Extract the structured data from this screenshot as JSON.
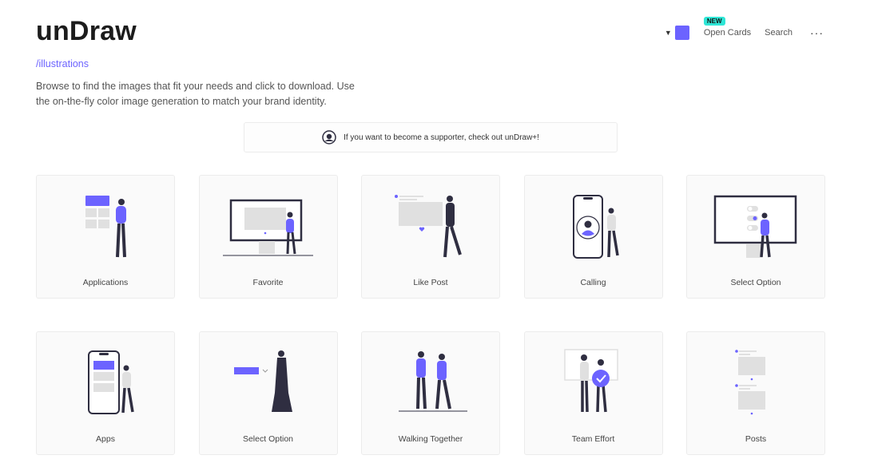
{
  "header": {
    "logo": "unDraw",
    "subtitle": "/illustrations",
    "description": "Browse to find the images that fit your needs and click to download. Use the on-the-fly color image generation to match your brand identity."
  },
  "nav": {
    "caret_icon": "caret-down-icon",
    "color_swatch": "#6c63ff",
    "new_badge": "NEW",
    "open_cards": "Open Cards",
    "search": "Search",
    "more": "···"
  },
  "banner": {
    "text": "If you want to become a supporter, check out unDraw+!"
  },
  "colors": {
    "accent": "#6c63ff",
    "dark": "#2f2e41",
    "gray": "#e6e6e6"
  },
  "cards": [
    {
      "label": "Applications"
    },
    {
      "label": "Favorite"
    },
    {
      "label": "Like Post"
    },
    {
      "label": "Calling"
    },
    {
      "label": "Select Option"
    },
    {
      "label": "Apps"
    },
    {
      "label": "Select Option"
    },
    {
      "label": "Walking Together"
    },
    {
      "label": "Team Effort"
    },
    {
      "label": "Posts"
    }
  ]
}
